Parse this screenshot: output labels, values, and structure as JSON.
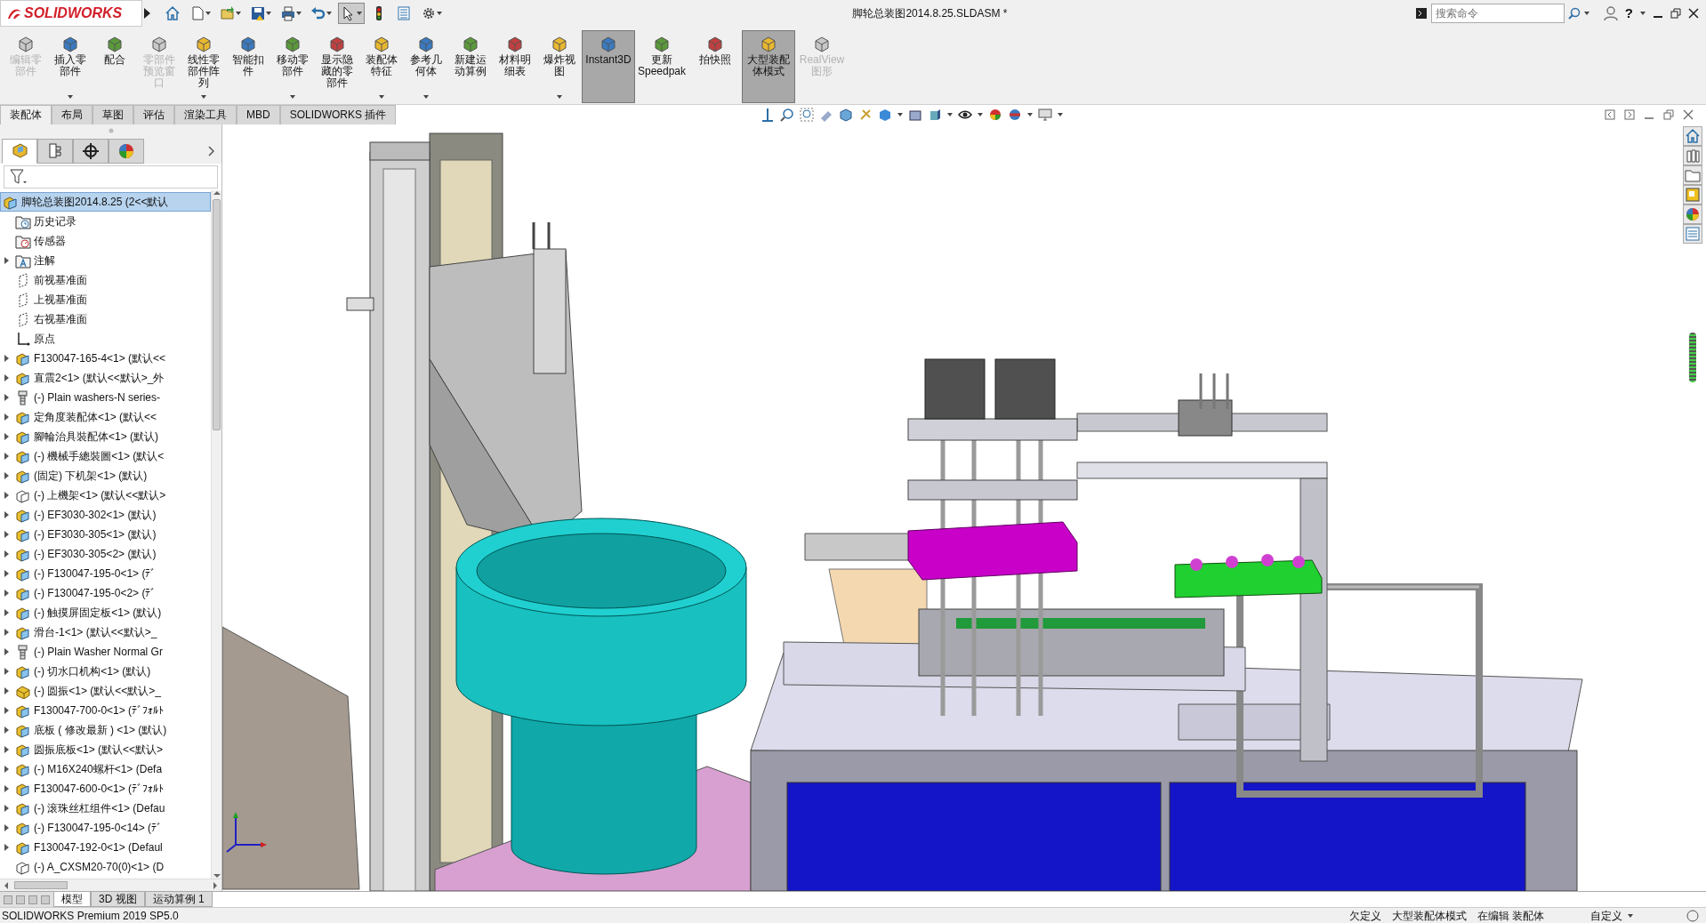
{
  "title_bar": {
    "logo": "SOLIDWORKS",
    "document_title": "脚轮总装图2014.8.25.SLDASM *",
    "search": {
      "placeholder": "搜索命令"
    },
    "help": "?"
  },
  "commands": [
    {
      "label": "编辑零部件",
      "disabled": true,
      "selected": false,
      "dropdown": false
    },
    {
      "label": "插入零部件",
      "disabled": false,
      "selected": false,
      "dropdown": true
    },
    {
      "label": "配合",
      "disabled": false,
      "selected": false,
      "dropdown": false
    },
    {
      "label": "零部件预览窗口",
      "disabled": true,
      "selected": false,
      "dropdown": false
    },
    {
      "label": "线性零部件阵列",
      "disabled": false,
      "selected": false,
      "dropdown": true
    },
    {
      "label": "智能扣件",
      "disabled": false,
      "selected": false,
      "dropdown": false
    },
    {
      "label": "移动零部件",
      "disabled": false,
      "selected": false,
      "dropdown": true
    },
    {
      "label": "显示隐藏的零部件",
      "disabled": false,
      "selected": false,
      "dropdown": false
    },
    {
      "label": "装配体特征",
      "disabled": false,
      "selected": false,
      "dropdown": true
    },
    {
      "label": "参考几何体",
      "disabled": false,
      "selected": false,
      "dropdown": true
    },
    {
      "label": "新建运动算例",
      "disabled": false,
      "selected": false,
      "dropdown": false
    },
    {
      "label": "材料明细表",
      "disabled": false,
      "selected": false,
      "dropdown": false
    },
    {
      "label": "爆炸视图",
      "disabled": false,
      "selected": false,
      "dropdown": true
    },
    {
      "label": "Instant3D",
      "disabled": false,
      "selected": true,
      "dropdown": false
    },
    {
      "label": "更新 Speedpak",
      "disabled": false,
      "selected": false,
      "dropdown": false
    },
    {
      "label": "拍快照",
      "disabled": false,
      "selected": false,
      "dropdown": false
    },
    {
      "label": "大型装配体模式",
      "disabled": false,
      "selected": true,
      "dropdown": false
    },
    {
      "label": "RealView 图形",
      "disabled": true,
      "selected": false,
      "dropdown": false
    }
  ],
  "command_tabs": [
    {
      "label": "装配体",
      "selected": true
    },
    {
      "label": "布局",
      "selected": false
    },
    {
      "label": "草图",
      "selected": false
    },
    {
      "label": "评估",
      "selected": false
    },
    {
      "label": "渲染工具",
      "selected": false
    },
    {
      "label": "MBD",
      "selected": false
    },
    {
      "label": "SOLIDWORKS 插件",
      "selected": false
    }
  ],
  "manager_tabs": [
    {
      "kind": "feature",
      "selected": true
    },
    {
      "kind": "property",
      "selected": false
    },
    {
      "kind": "configuration",
      "selected": false
    },
    {
      "kind": "display",
      "selected": false
    }
  ],
  "feature_tree": {
    "root": {
      "label": "脚轮总装图2014.8.25 (2<<默认",
      "selected": true
    },
    "items": [
      {
        "label": "历史记录",
        "kind": "history",
        "expandable": false
      },
      {
        "label": "传感器",
        "kind": "sensors",
        "expandable": false
      },
      {
        "label": "注解",
        "kind": "annotations",
        "expandable": true
      },
      {
        "label": "前视基准面",
        "kind": "plane",
        "expandable": false
      },
      {
        "label": "上视基准面",
        "kind": "plane",
        "expandable": false
      },
      {
        "label": "右视基准面",
        "kind": "plane",
        "expandable": false
      },
      {
        "label": "原点",
        "kind": "origin",
        "expandable": false
      },
      {
        "label": "F130047-165-4<1> (默认<<",
        "kind": "assembly",
        "expandable": true
      },
      {
        "label": "直震2<1> (默认<<默认>_外",
        "kind": "assembly",
        "expandable": true
      },
      {
        "label": "(-) Plain washers-N series-",
        "kind": "fastener",
        "expandable": true
      },
      {
        "label": "定角度装配体<1> (默认<<",
        "kind": "assembly",
        "expandable": true
      },
      {
        "label": "腳輪治具裝配体<1> (默认)",
        "kind": "assembly",
        "expandable": true
      },
      {
        "label": "(-) 機械手總裝圖<1> (默认<",
        "kind": "assembly",
        "expandable": true
      },
      {
        "label": "(固定) 下机架<1> (默认)",
        "kind": "assembly",
        "expandable": true
      },
      {
        "label": "(-) 上機架<1> (默认<<默认>",
        "kind": "assembly-outline",
        "expandable": true
      },
      {
        "label": "(-) EF3030-302<1> (默认)",
        "kind": "assembly",
        "expandable": true
      },
      {
        "label": "(-) EF3030-305<1> (默认)",
        "kind": "assembly",
        "expandable": true
      },
      {
        "label": "(-) EF3030-305<2> (默认)",
        "kind": "assembly",
        "expandable": true
      },
      {
        "label": "(-) F130047-195-0<1> (ﾃﾞ",
        "kind": "assembly",
        "expandable": true
      },
      {
        "label": "(-) F130047-195-0<2> (ﾃﾞ",
        "kind": "assembly",
        "expandable": true
      },
      {
        "label": "(-) 触摸屏固定板<1> (默认)",
        "kind": "assembly",
        "expandable": true
      },
      {
        "label": "滑台-1<1> (默认<<默认>_",
        "kind": "assembly",
        "expandable": true
      },
      {
        "label": "(-) Plain Washer Normal Gr",
        "kind": "fastener",
        "expandable": true
      },
      {
        "label": "(-) 切水口机构<1> (默认)",
        "kind": "assembly",
        "expandable": true
      },
      {
        "label": "(-) 圆振<1> (默认<<默认>_",
        "kind": "part",
        "expandable": true
      },
      {
        "label": "F130047-700-0<1> (ﾃﾞﾌｫﾙﾄ",
        "kind": "assembly",
        "expandable": true
      },
      {
        "label": "底板 ( 修改最新 ) <1> (默认)",
        "kind": "assembly",
        "expandable": true
      },
      {
        "label": "圆振底板<1> (默认<<默认>",
        "kind": "assembly",
        "expandable": true
      },
      {
        "label": "(-) M16X240螺杆<1> (Defa",
        "kind": "assembly",
        "expandable": true
      },
      {
        "label": "F130047-600-0<1> (ﾃﾞﾌｫﾙﾄ",
        "kind": "assembly",
        "expandable": true
      },
      {
        "label": "(-) 滚珠丝杠组件<1> (Defau",
        "kind": "assembly",
        "expandable": true
      },
      {
        "label": "(-) F130047-195-0<14> (ﾃﾞ",
        "kind": "assembly",
        "expandable": true
      },
      {
        "label": "F130047-192-0<1> (Defaul",
        "kind": "assembly",
        "expandable": true
      },
      {
        "label": "(-) A_CXSM20-70(0)<1> (D",
        "kind": "assembly-outline",
        "expandable": false
      }
    ]
  },
  "bottom_tabs": [
    {
      "label": "模型",
      "selected": true
    },
    {
      "label": "3D 视图",
      "selected": false
    },
    {
      "label": "运动算例 1",
      "selected": false
    }
  ],
  "status_bar": {
    "product": "SOLIDWORKS Premium 2019 SP5.0",
    "items": [
      "欠定义",
      "大型装配体模式",
      "在编辑 装配体",
      "自定义"
    ]
  }
}
